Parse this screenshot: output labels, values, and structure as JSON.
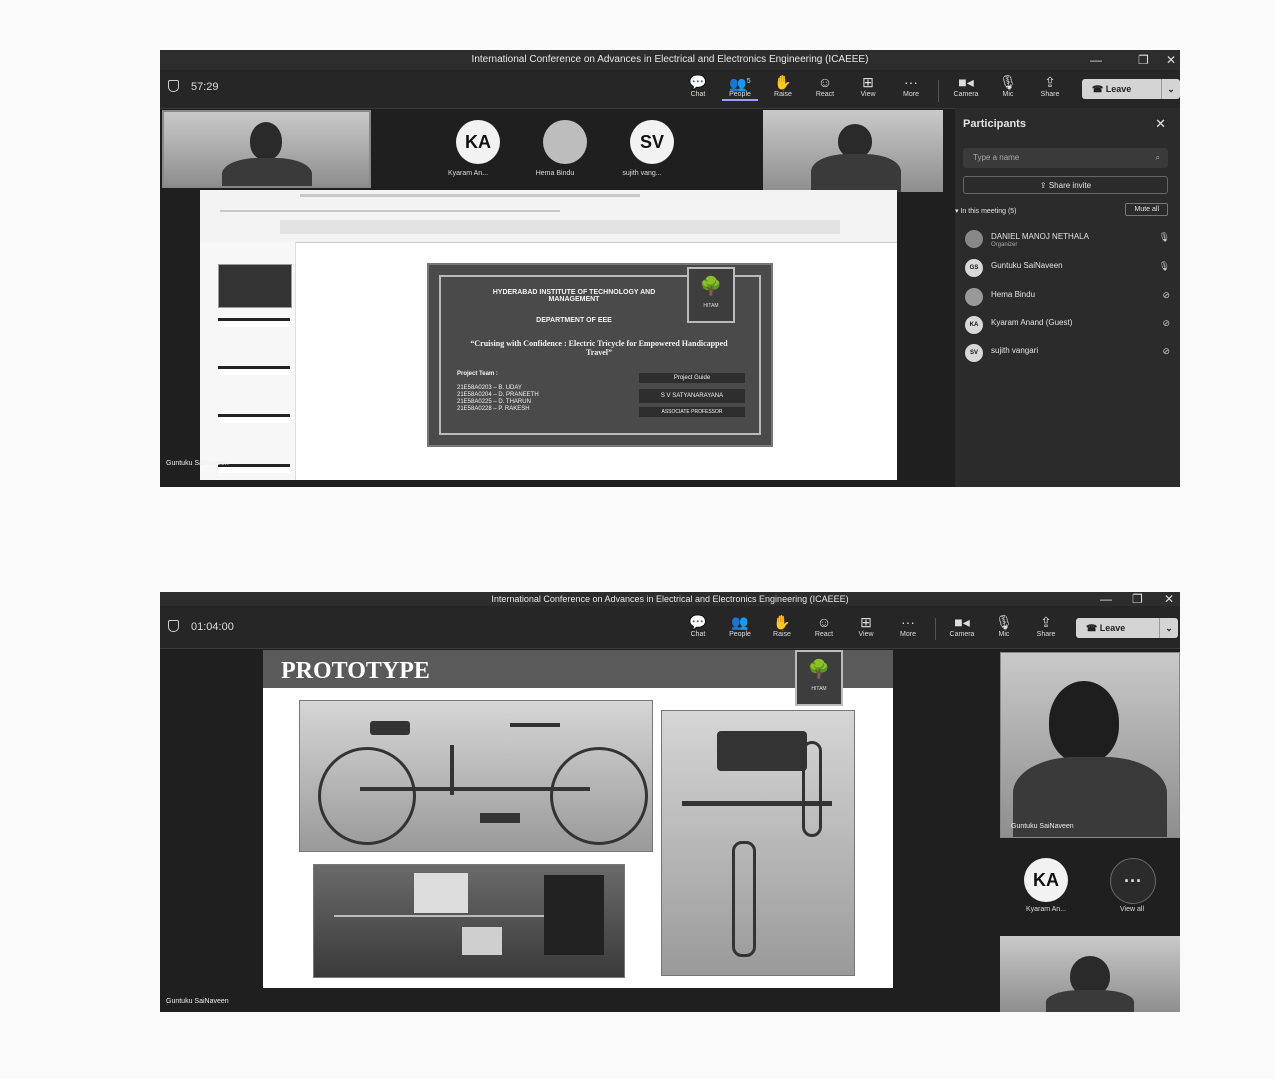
{
  "screens": [
    {
      "window_title": "International Conference on Advances in Electrical and Electronics Engineering (ICAEEE)",
      "timer": "57:29",
      "toolbar": {
        "chat": "Chat",
        "people": "People",
        "people_count": "5",
        "raise": "Raise",
        "react": "React",
        "view": "View",
        "more": "More",
        "camera": "Camera",
        "mic": "Mic",
        "share": "Share",
        "leave": "Leave"
      },
      "gallery": [
        {
          "initials": "KA",
          "label": "Kyaram An..."
        },
        {
          "initials": "",
          "label": "Hema Bindu"
        },
        {
          "initials": "SV",
          "label": "sujith vang..."
        }
      ],
      "participants_panel": {
        "title": "Participants",
        "search_placeholder": "Type a name",
        "share_invite": "Share invite",
        "in_meeting": "In this meeting (5)",
        "mute_all": "Mute all",
        "people": [
          {
            "initials": "",
            "name": "DANIEL MANOJ NETHALA",
            "role": "Organizer"
          },
          {
            "initials": "GS",
            "name": "Guntuku SaiNaveen",
            "role": ""
          },
          {
            "initials": "",
            "name": "Hema Bindu",
            "role": ""
          },
          {
            "initials": "KA",
            "name": "Kyaram Anand (Guest)",
            "role": ""
          },
          {
            "initials": "SV",
            "name": "sujith vangari",
            "role": ""
          }
        ]
      },
      "presenter_name": "Guntuku SaiNaveen",
      "slide": {
        "institute": "HYDERABAD INSTITUTE OF TECHNOLOGY AND MANAGEMENT",
        "department": "DEPARTMENT OF EEE",
        "project_title": "“Cruising with Confidence : Electric Tricycle for Empowered Handicapped Travel”",
        "team_heading": "Project Team :",
        "team": [
          "21E58A0203 – B. UDAY",
          "21E58A0204 – D. PRANEETH",
          "21E58A0225 – D. THARUN",
          "21E58A0228 – P. RAKESH"
        ],
        "guide_heading": "Project Guide",
        "guide_name": "S V SATYANARAYANA",
        "guide_title": "ASSOCIATE PROFESSOR",
        "logo_text": "HITAM"
      }
    },
    {
      "window_title": "International Conference on Advances in Electrical and Electronics Engineering (ICAEEE)",
      "timer": "01:04:00",
      "toolbar": {
        "chat": "Chat",
        "people": "People",
        "raise": "Raise",
        "react": "React",
        "view": "View",
        "more": "More",
        "camera": "Camera",
        "mic": "Mic",
        "share": "Share",
        "leave": "Leave"
      },
      "slide_title": "PROTOTYPE",
      "logo_text": "HITAM",
      "side_video_name": "Guntuku SaiNaveen",
      "gallery": [
        {
          "initials": "KA",
          "label": "Kyaram An..."
        },
        {
          "initials": "···",
          "label": "View all"
        }
      ],
      "presenter_name": "Guntuku SaiNaveen"
    }
  ]
}
